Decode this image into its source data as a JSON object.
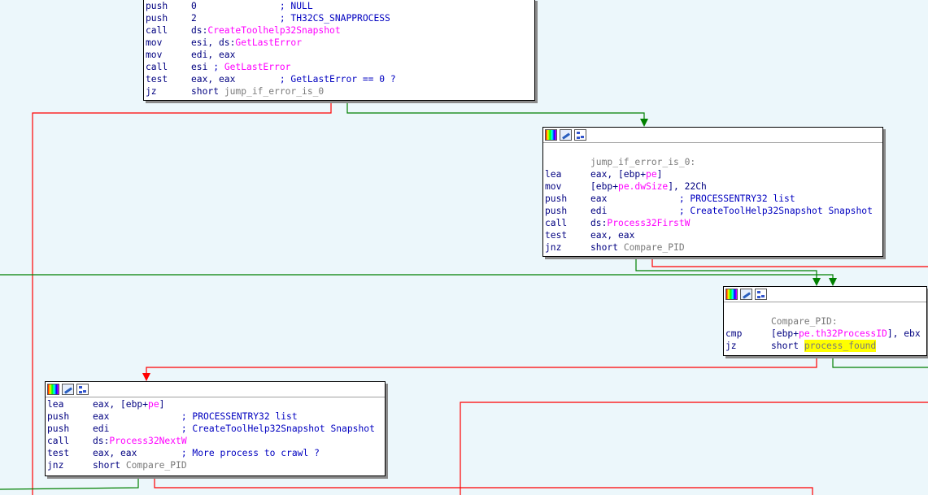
{
  "colors": {
    "background": "#ecf7fb",
    "edge_true": "#008000",
    "edge_false": "#ff0000",
    "edge_normal": "#0000ff",
    "import_name": "#ff00ff",
    "comment": "#0000c0",
    "label": "#7a7a7a",
    "highlight": "#ffff00"
  },
  "toolbar_icons": [
    "color-palette-icon",
    "rename-pencil-icon",
    "graph-overview-icon"
  ],
  "blocks": [
    {
      "id": "block-0",
      "has_titlebar": false,
      "lines": [
        {
          "mn": "push",
          "parts": [
            {
              "t": "0",
              "c": "op"
            },
            {
              "t": "               ; NULL",
              "c": "cmt"
            }
          ]
        },
        {
          "mn": "push",
          "parts": [
            {
              "t": "2",
              "c": "op"
            },
            {
              "t": "               ; TH32CS_SNAPPROCESS",
              "c": "cmt"
            }
          ]
        },
        {
          "mn": "call",
          "parts": [
            {
              "t": "ds:",
              "c": "op"
            },
            {
              "t": "CreateToolhelp32Snapshot",
              "c": "imp"
            }
          ]
        },
        {
          "mn": "mov",
          "parts": [
            {
              "t": "esi, ds:",
              "c": "op"
            },
            {
              "t": "GetLastError",
              "c": "imp"
            }
          ]
        },
        {
          "mn": "mov",
          "parts": [
            {
              "t": "edi, eax",
              "c": "op"
            }
          ]
        },
        {
          "mn": "call",
          "parts": [
            {
              "t": "esi",
              "c": "op"
            },
            {
              "t": " ; ",
              "c": "cmt"
            },
            {
              "t": "GetLastError",
              "c": "imp"
            }
          ]
        },
        {
          "mn": "test",
          "parts": [
            {
              "t": "eax, eax",
              "c": "op"
            },
            {
              "t": "        ; GetLastError == 0 ?",
              "c": "cmt"
            }
          ]
        },
        {
          "mn": "jz",
          "parts": [
            {
              "t": "short ",
              "c": "op"
            },
            {
              "t": "jump_if_error_is_0",
              "c": "lbl"
            }
          ]
        }
      ]
    },
    {
      "id": "block-1",
      "has_titlebar": true,
      "lines": [
        {
          "mn": "",
          "parts": [
            {
              "t": "",
              "c": "op"
            }
          ]
        },
        {
          "mn": "",
          "parts": [
            {
              "t": "jump_if_error_is_0:",
              "c": "lbl"
            }
          ]
        },
        {
          "mn": "lea",
          "parts": [
            {
              "t": "eax, [ebp+",
              "c": "op"
            },
            {
              "t": "pe",
              "c": "imp"
            },
            {
              "t": "]",
              "c": "op"
            }
          ]
        },
        {
          "mn": "mov",
          "parts": [
            {
              "t": "[ebp+",
              "c": "op"
            },
            {
              "t": "pe.dwSize",
              "c": "imp"
            },
            {
              "t": "], 22Ch",
              "c": "op"
            }
          ]
        },
        {
          "mn": "push",
          "parts": [
            {
              "t": "eax",
              "c": "op"
            },
            {
              "t": "             ; PROCESSENTRY32 list",
              "c": "cmt"
            }
          ]
        },
        {
          "mn": "push",
          "parts": [
            {
              "t": "edi",
              "c": "op"
            },
            {
              "t": "             ; CreateToolHelp32Snapshot Snapshot",
              "c": "cmt"
            }
          ]
        },
        {
          "mn": "call",
          "parts": [
            {
              "t": "ds:",
              "c": "op"
            },
            {
              "t": "Process32FirstW",
              "c": "imp"
            }
          ]
        },
        {
          "mn": "test",
          "parts": [
            {
              "t": "eax, eax",
              "c": "op"
            }
          ]
        },
        {
          "mn": "jnz",
          "parts": [
            {
              "t": "short ",
              "c": "op"
            },
            {
              "t": "Compare_PID",
              "c": "lbl"
            }
          ]
        }
      ]
    },
    {
      "id": "block-2",
      "has_titlebar": true,
      "lines": [
        {
          "mn": "",
          "parts": [
            {
              "t": "",
              "c": "op"
            }
          ]
        },
        {
          "mn": "",
          "parts": [
            {
              "t": "Compare_PID:",
              "c": "lbl"
            }
          ]
        },
        {
          "mn": "cmp",
          "parts": [
            {
              "t": "[ebp+",
              "c": "op"
            },
            {
              "t": "pe.th32ProcessID",
              "c": "imp"
            },
            {
              "t": "], ebx",
              "c": "op"
            }
          ]
        },
        {
          "mn": "jz",
          "parts": [
            {
              "t": "short ",
              "c": "op"
            },
            {
              "t": "process_found",
              "c": "hl"
            }
          ]
        }
      ]
    },
    {
      "id": "block-3",
      "has_titlebar": true,
      "lines": [
        {
          "mn": "lea",
          "parts": [
            {
              "t": "eax, [ebp+",
              "c": "op"
            },
            {
              "t": "pe",
              "c": "imp"
            },
            {
              "t": "]",
              "c": "op"
            }
          ]
        },
        {
          "mn": "push",
          "parts": [
            {
              "t": "eax",
              "c": "op"
            },
            {
              "t": "             ; PROCESSENTRY32 list",
              "c": "cmt"
            }
          ]
        },
        {
          "mn": "push",
          "parts": [
            {
              "t": "edi",
              "c": "op"
            },
            {
              "t": "             ; CreateToolHelp32Snapshot Snapshot",
              "c": "cmt"
            }
          ]
        },
        {
          "mn": "call",
          "parts": [
            {
              "t": "ds:",
              "c": "op"
            },
            {
              "t": "Process32NextW",
              "c": "imp"
            }
          ]
        },
        {
          "mn": "test",
          "parts": [
            {
              "t": "eax, eax",
              "c": "op"
            },
            {
              "t": "        ; More process to crawl ?",
              "c": "cmt"
            }
          ]
        },
        {
          "mn": "jnz",
          "parts": [
            {
              "t": "short ",
              "c": "op"
            },
            {
              "t": "Compare_PID",
              "c": "lbl"
            }
          ]
        }
      ]
    }
  ]
}
